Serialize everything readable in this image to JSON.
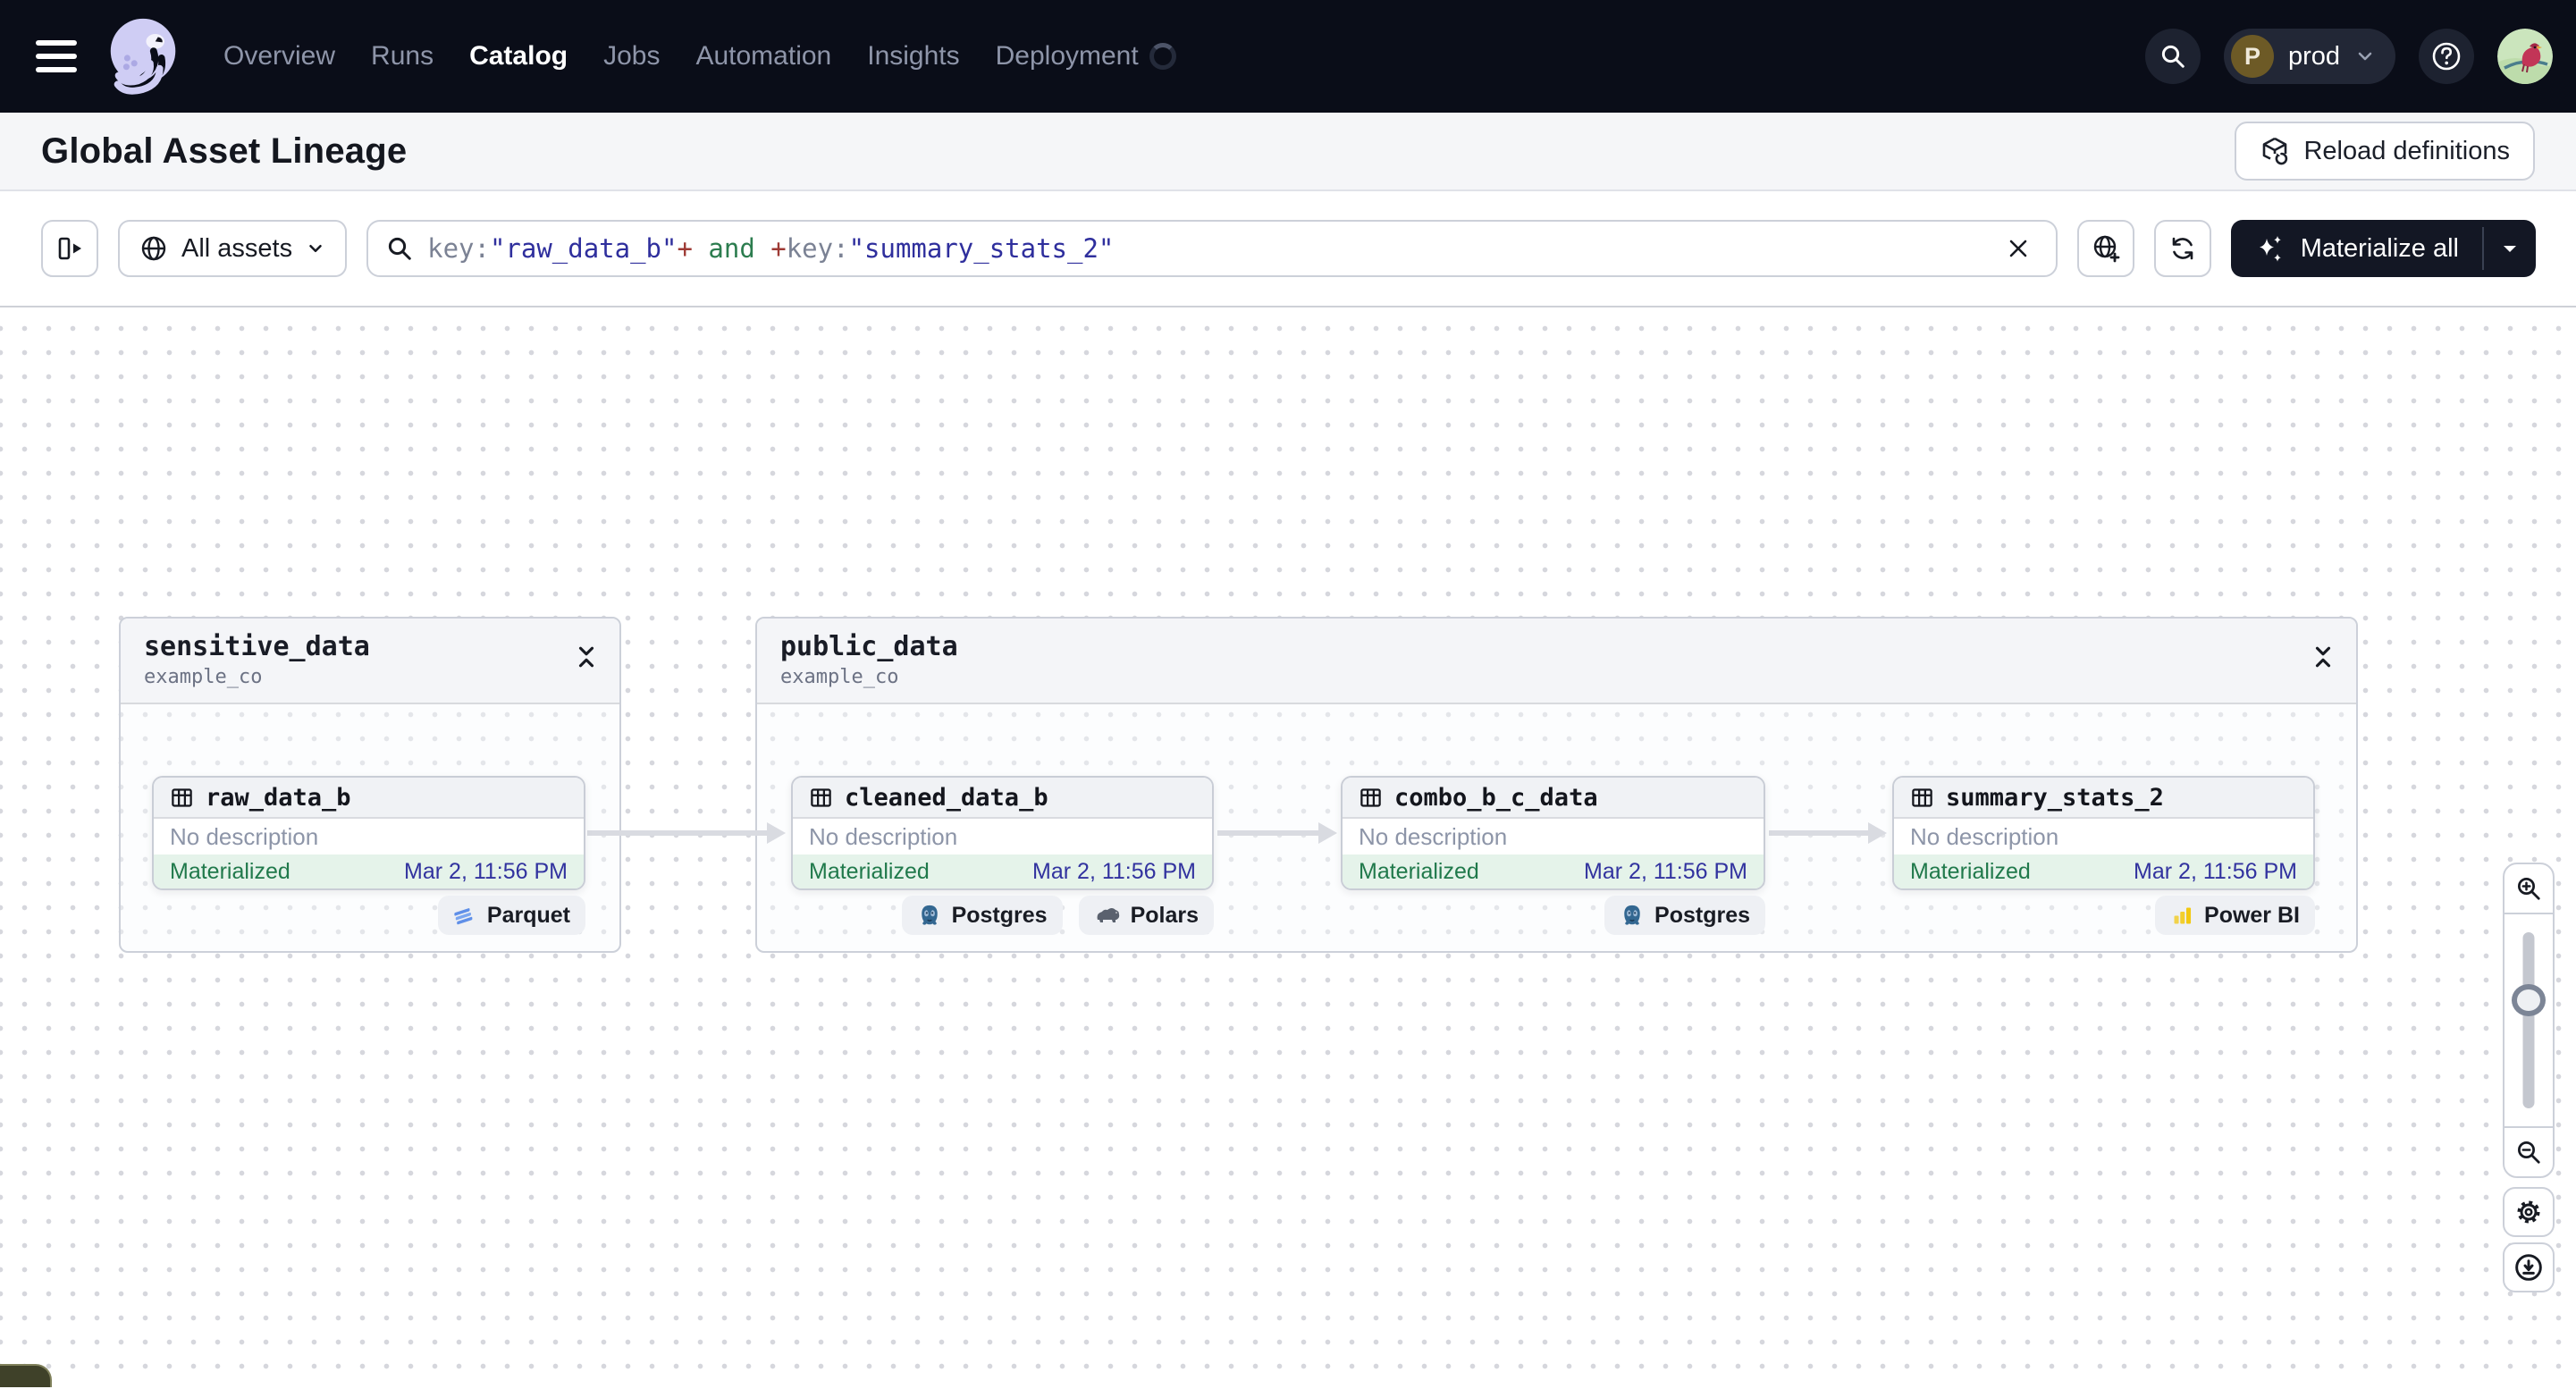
{
  "nav": {
    "menu": [
      "Overview",
      "Runs",
      "Catalog",
      "Jobs",
      "Automation",
      "Insights",
      "Deployment"
    ],
    "active_item": "Catalog",
    "deployment_switcher": {
      "initial": "P",
      "label": "prod"
    }
  },
  "page_header": {
    "title": "Global Asset Lineage",
    "reload_button_label": "Reload definitions"
  },
  "toolbar": {
    "scope_dropdown_label": "All assets",
    "search": {
      "segments": {
        "key_a": "key:",
        "value_a": "\"raw_data_b\"",
        "plus_a": "+",
        "and_op": " and ",
        "plus_b": "+",
        "key_b": "key:",
        "value_b": "\"summary_stats_2\""
      }
    },
    "materialize_button_label": "Materialize all"
  },
  "graph": {
    "groups": [
      {
        "name": "sensitive_data",
        "location": "example_co"
      },
      {
        "name": "public_data",
        "location": "example_co"
      }
    ],
    "assets": [
      {
        "name": "raw_data_b",
        "description": "No description",
        "status": "Materialized",
        "timestamp": "Mar 2, 11:56 PM",
        "tags": [
          "Parquet"
        ]
      },
      {
        "name": "cleaned_data_b",
        "description": "No description",
        "status": "Materialized",
        "timestamp": "Mar 2, 11:56 PM",
        "tags": [
          "Postgres",
          "Polars"
        ]
      },
      {
        "name": "combo_b_c_data",
        "description": "No description",
        "status": "Materialized",
        "timestamp": "Mar 2, 11:56 PM",
        "tags": [
          "Postgres"
        ]
      },
      {
        "name": "summary_stats_2",
        "description": "No description",
        "status": "Materialized",
        "timestamp": "Mar 2, 11:56 PM",
        "tags": [
          "Power BI"
        ]
      }
    ]
  },
  "colors": {
    "nav_background": "#0a0d18",
    "accent_materialized_text": "#20794b",
    "materialized_background": "#e5f3ea",
    "timestamp_text": "#32339f",
    "query_value": "#2f2f9d",
    "query_and": "#2c7d4f",
    "query_plus": "#9e3a34",
    "dark_button": "#131724"
  }
}
